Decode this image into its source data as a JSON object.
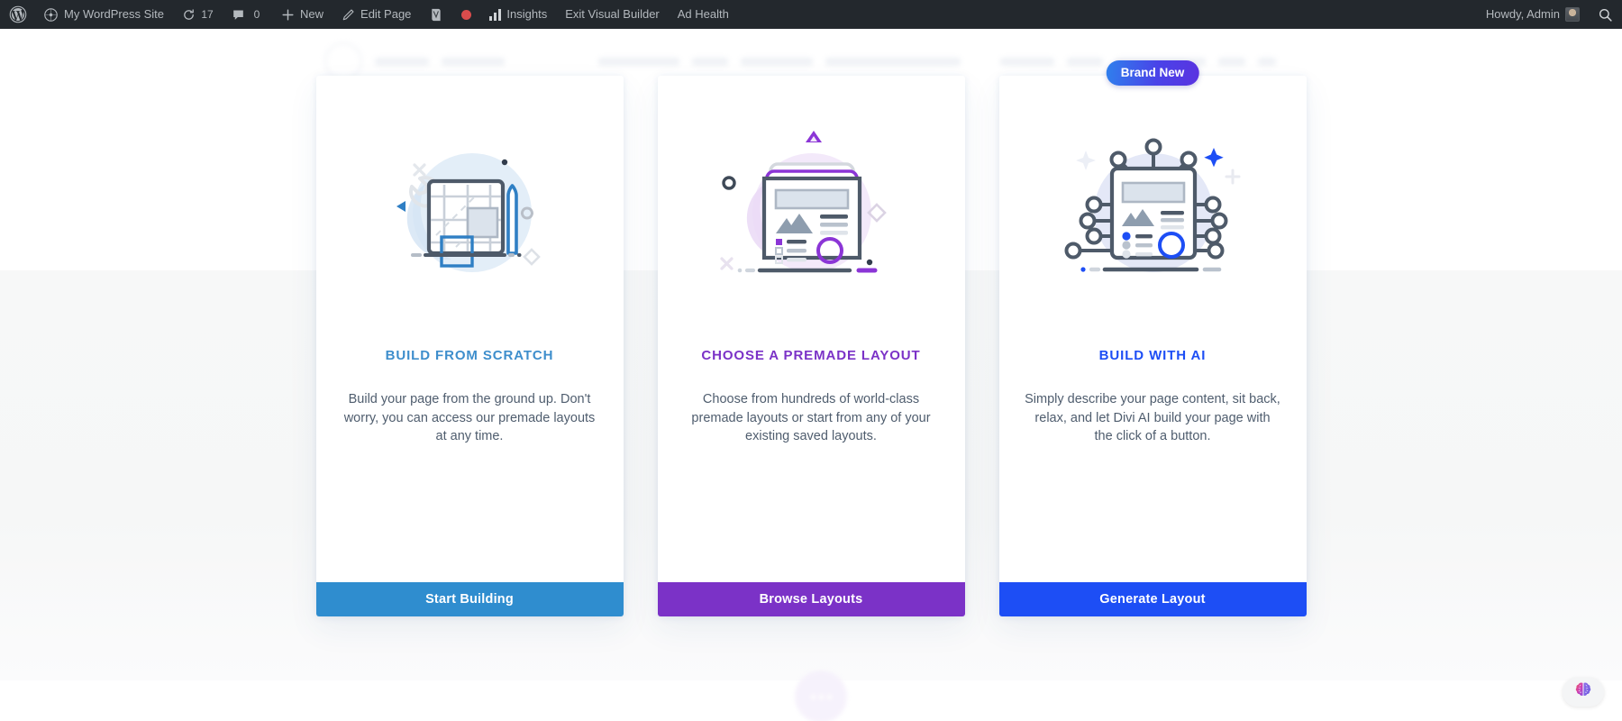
{
  "admin_bar": {
    "wp_logo": "wordpress-logo-icon",
    "site_name": "My WordPress Site",
    "updates_icon": "updates-icon",
    "updates_count": "17",
    "comments_icon": "comment-bubble-icon",
    "comments_count": "0",
    "new_icon": "plus-icon",
    "new_label": "New",
    "edit_icon": "pencil-icon",
    "edit_label": "Edit Page",
    "yoast_icon": "yoast-seo-icon",
    "rec_icon": "record-dot-icon",
    "insights_icon": "bar-chart-icon",
    "insights_label": "Insights",
    "exit_vb_label": "Exit Visual Builder",
    "ad_health_label": "Ad Health",
    "howdy_label": "Howdy, Admin",
    "avatar": "user-avatar",
    "search_icon": "search-icon"
  },
  "colors": {
    "scratch_accent": "#3e8ecc",
    "premade_accent": "#7b32c7",
    "ai_accent": "#1d4ef5",
    "badge_from": "#2f80ed",
    "badge_to": "#5a33e0",
    "admin_bar_bg": "#23282d",
    "body_text": "#4f5d6e"
  },
  "cards": [
    {
      "id": "build-from-scratch",
      "illustration": "blueprint-wireframe-illustration",
      "title": "BUILD FROM SCRATCH",
      "description": "Build your page from the ground up. Don't worry, you can access our premade layouts at any time.",
      "button_label": "Start Building",
      "button_color": "#2f8dcf",
      "title_color": "#3e8ecc",
      "badge": null
    },
    {
      "id": "choose-a-premade-layout",
      "illustration": "premade-layout-page-illustration",
      "title": "CHOOSE A PREMADE LAYOUT",
      "description": "Choose from hundreds of world-class premade layouts or start from any of your existing saved layouts.",
      "button_label": "Browse Layouts",
      "button_color": "#7b32c7",
      "title_color": "#7b32c7",
      "badge": null
    },
    {
      "id": "build-with-ai",
      "illustration": "ai-neural-network-page-illustration",
      "title": "BUILD WITH AI",
      "description": "Simply describe your page content, sit back, relax, and let Divi AI build your page with the click of a button.",
      "button_label": "Generate Layout",
      "button_color": "#1d4ef5",
      "title_color": "#1d4ef5",
      "badge": "Brand New"
    }
  ],
  "floating": {
    "ai_bubble_icon": "divi-ai-brain-icon"
  }
}
